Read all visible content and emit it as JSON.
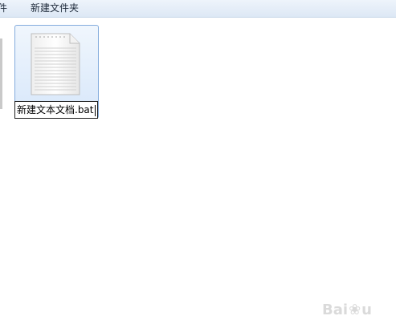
{
  "toolbar": {
    "partial_label": "件",
    "new_folder_label": "新建文件夹"
  },
  "file": {
    "icon": "text-document-icon",
    "rename_value": "新建文本文档.bat"
  },
  "watermark": {
    "text_left": "Bai",
    "text_right": "u"
  }
}
